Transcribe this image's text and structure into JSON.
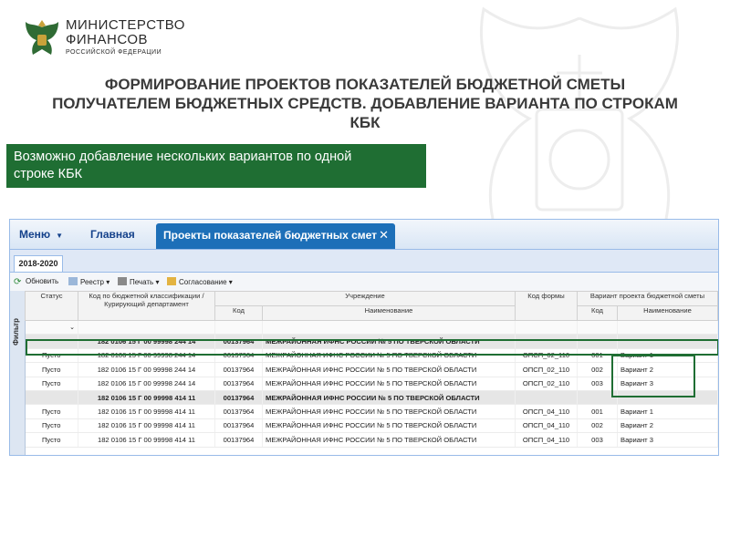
{
  "header": {
    "ministry_line1": "МИНИСТЕРСТВО",
    "ministry_line2": "ФИНАНСОВ",
    "ministry_line3": "РОССИЙСКОЙ ФЕДЕРАЦИИ",
    "title_line1": "ФОРМИРОВАНИЕ ПРОЕКТОВ ПОКАЗАТЕЛЕЙ БЮДЖЕТНОЙ СМЕТЫ",
    "title_line2": "ПОЛУЧАТЕЛЕМ БЮДЖЕТНЫХ СРЕДСТВ. ДОБАВЛЕНИЕ ВАРИАНТА ПО СТРОКАМ",
    "title_line3": "КБК"
  },
  "callout": {
    "line1": "Возможно добавление нескольких вариантов по одной",
    "line2": "строке КБК"
  },
  "app": {
    "menu_label": "Меню",
    "main_label": "Главная",
    "active_tab": "Проекты показателей бюджетных смет",
    "year_tab": "2018-2020",
    "filter_label": "Фильтр",
    "toolbar": {
      "refresh": "Обновить",
      "registry": "Реестр",
      "print": "Печать",
      "approval": "Согласование"
    },
    "columns": {
      "status": "Статус",
      "kbk": "Код по бюджетной классификации / Курирующий департамент",
      "institution": "Учреждение",
      "inst_code": "Код",
      "inst_name": "Наименование",
      "form_code": "Код формы",
      "variant": "Вариант проекта бюджетной сметы",
      "var_code": "Код",
      "var_name": "Наименование"
    },
    "rows": [
      {
        "group": true,
        "status": "",
        "kbk": "182 0106 15 Г 00 99998 244 14",
        "code": "00137964",
        "name": "МЕЖРАЙОННАЯ ИФНС РОССИИ № 5 ПО ТВЕРСКОЙ ОБЛАСТИ",
        "form": "",
        "vcode": "",
        "vname": ""
      },
      {
        "group": false,
        "status": "Пусто",
        "kbk": "182 0106 15 Г 00 99998 244 14",
        "code": "00137964",
        "name": "МЕЖРАЙОННАЯ ИФНС РОССИИ № 5 ПО ТВЕРСКОЙ ОБЛАСТИ",
        "form": "ОПСП_02_110",
        "vcode": "001",
        "vname": "Вариант 1"
      },
      {
        "group": false,
        "status": "Пусто",
        "kbk": "182 0106 15 Г 00 99998 244 14",
        "code": "00137964",
        "name": "МЕЖРАЙОННАЯ ИФНС РОССИИ № 5 ПО ТВЕРСКОЙ ОБЛАСТИ",
        "form": "ОПСП_02_110",
        "vcode": "002",
        "vname": "Вариант 2"
      },
      {
        "group": false,
        "status": "Пусто",
        "kbk": "182 0106 15 Г 00 99998 244 14",
        "code": "00137964",
        "name": "МЕЖРАЙОННАЯ ИФНС РОССИИ № 5 ПО ТВЕРСКОЙ ОБЛАСТИ",
        "form": "ОПСП_02_110",
        "vcode": "003",
        "vname": "Вариант 3"
      },
      {
        "group": true,
        "status": "",
        "kbk": "182 0106 15 Г 00 99998 414 11",
        "code": "00137964",
        "name": "МЕЖРАЙОННАЯ ИФНС РОССИИ № 5 ПО ТВЕРСКОЙ ОБЛАСТИ",
        "form": "",
        "vcode": "",
        "vname": ""
      },
      {
        "group": false,
        "status": "Пусто",
        "kbk": "182 0106 15 Г 00 99998 414 11",
        "code": "00137964",
        "name": "МЕЖРАЙОННАЯ ИФНС РОССИИ № 5 ПО ТВЕРСКОЙ ОБЛАСТИ",
        "form": "ОПСП_04_110",
        "vcode": "001",
        "vname": "Вариант 1"
      },
      {
        "group": false,
        "status": "Пусто",
        "kbk": "182 0106 15 Г 00 99998 414 11",
        "code": "00137964",
        "name": "МЕЖРАЙОННАЯ ИФНС РОССИИ № 5 ПО ТВЕРСКОЙ ОБЛАСТИ",
        "form": "ОПСП_04_110",
        "vcode": "002",
        "vname": "Вариант 2"
      },
      {
        "group": false,
        "status": "Пусто",
        "kbk": "182 0106 15 Г 00 99998 414 11",
        "code": "00137964",
        "name": "МЕЖРАЙОННАЯ ИФНС РОССИИ № 5 ПО ТВЕРСКОЙ ОБЛАСТИ",
        "form": "ОПСП_04_110",
        "vcode": "003",
        "vname": "Вариант 3"
      }
    ]
  },
  "colors": {
    "accent_green": "#1f6e33",
    "tab_blue": "#1d6fb8",
    "link_blue": "#15428b"
  }
}
